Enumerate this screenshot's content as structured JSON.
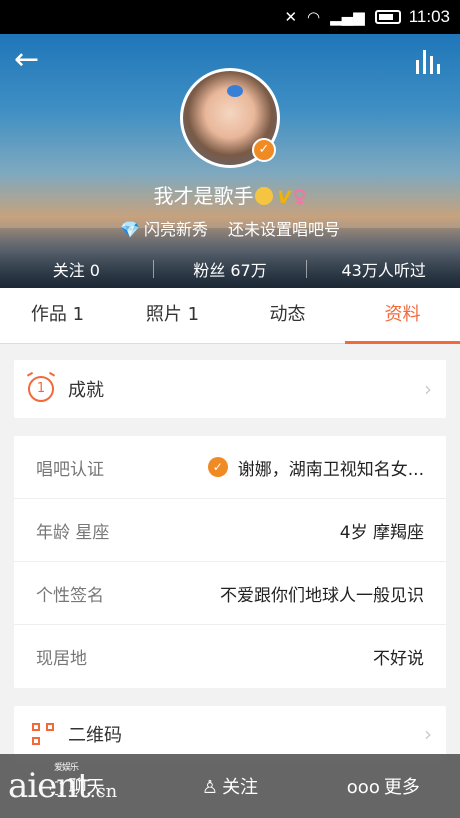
{
  "status_bar": {
    "time": "11:03"
  },
  "profile": {
    "nickname": "我才是歌手",
    "vip": "V",
    "gender_symbol": "♀",
    "level": "闪亮新秀",
    "chang_id": "还未设置唱吧号",
    "following": "关注 0",
    "fans": "粉丝 67万",
    "listens": "43万人听过"
  },
  "tabs": [
    {
      "label": "作品 1"
    },
    {
      "label": "照片 1"
    },
    {
      "label": "动态"
    },
    {
      "label": "资料"
    }
  ],
  "active_tab": "资料",
  "achievement": {
    "label": "成就",
    "icon_number": "1"
  },
  "info": {
    "certification": {
      "label": "唱吧认证",
      "value": "谢娜，湖南卫视知名女..."
    },
    "age_zodiac": {
      "label": "年龄 星座",
      "value": "4岁 摩羯座"
    },
    "signature": {
      "label": "个性签名",
      "value": "不爱跟你们地球人一般见识"
    },
    "location": {
      "label": "现居地",
      "value": "不好说"
    }
  },
  "qrcode": {
    "label": "二维码"
  },
  "bottom_bar": {
    "chat": "聊天",
    "follow": "关注",
    "more": "更多"
  },
  "watermark": {
    "text": "aien",
    "text2": "t",
    "domain": ".cn",
    "tag": "爱娱乐"
  },
  "colors": {
    "accent": "#f26a3b",
    "badge": "#f08a24"
  }
}
